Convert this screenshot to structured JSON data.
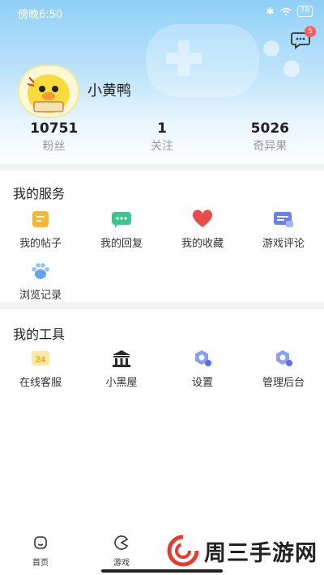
{
  "status_bar": {
    "time": "傍晚6:50",
    "battery": "78"
  },
  "header": {
    "message_badge": "5"
  },
  "profile": {
    "username": "小黄鸭"
  },
  "stats": [
    {
      "value": "10751",
      "label": "粉丝"
    },
    {
      "value": "1",
      "label": "关注"
    },
    {
      "value": "5026",
      "label": "奇异果"
    }
  ],
  "services": {
    "title": "我的服务",
    "items": [
      {
        "label": "我的帖子",
        "icon": "posts-icon"
      },
      {
        "label": "我的回复",
        "icon": "reply-icon"
      },
      {
        "label": "我的收藏",
        "icon": "heart-icon"
      },
      {
        "label": "游戏评论",
        "icon": "comment-icon"
      },
      {
        "label": "浏览记录",
        "icon": "paw-icon"
      }
    ]
  },
  "tools": {
    "title": "我的工具",
    "items": [
      {
        "label": "在线客服",
        "icon": "support-24-icon",
        "icon_text": "24"
      },
      {
        "label": "小黑屋",
        "icon": "blackhouse-icon"
      },
      {
        "label": "设置",
        "icon": "settings-icon"
      },
      {
        "label": "管理后台",
        "icon": "admin-icon"
      }
    ]
  },
  "bottom_nav": [
    {
      "label": "首页"
    },
    {
      "label": "游戏"
    }
  ],
  "watermark": {
    "text": "周三手游网"
  },
  "colors": {
    "accent_blue": "#5b8df2",
    "header_top": "#8fd0f7",
    "red": "#e94b4b"
  }
}
